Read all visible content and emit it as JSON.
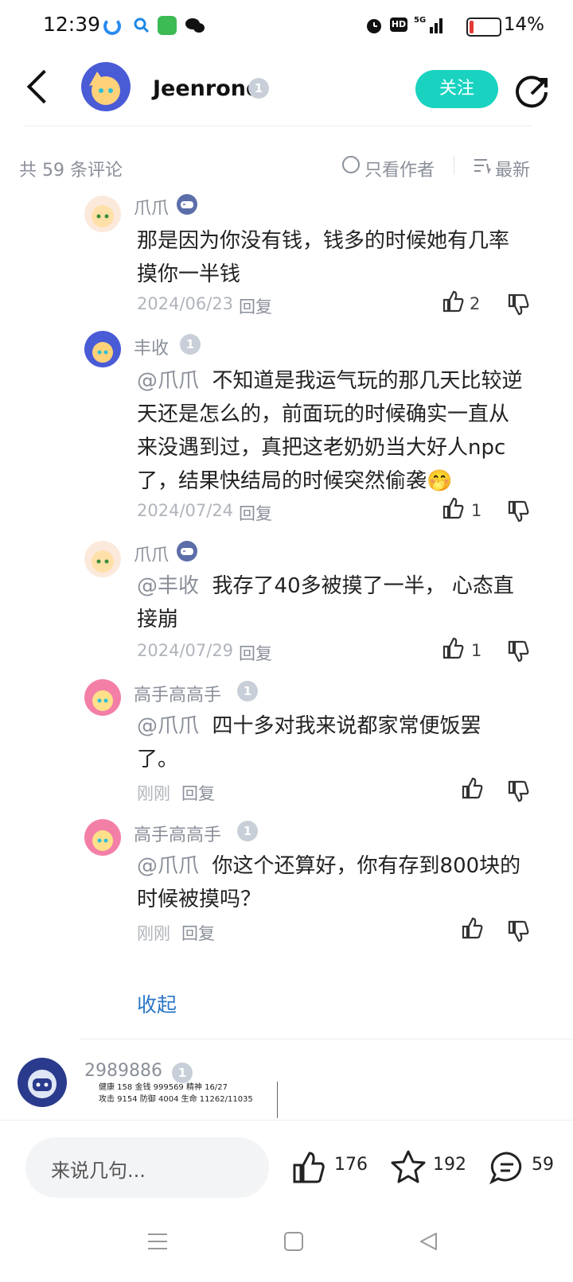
{
  "status_bar": {
    "time": "12:39",
    "battery": "14%",
    "battery_level": 0.14
  },
  "header": {
    "user_name": "Jeenrond",
    "follow_label": "关注"
  },
  "sort_bar": {
    "count_text": "共 59 条评论",
    "author_only": "只看作者",
    "sort_label": "最新"
  },
  "comments": [
    {
      "name": "爪爪",
      "mention": "",
      "text": "那是因为你没有钱，钱多的时候她有几率",
      "text2": "摸你一半钱",
      "date": "2024/06/23",
      "reply": "回复",
      "likes": "2"
    },
    {
      "name": "丰收",
      "mention": "@爪爪",
      "line1": "不知道是我运气玩的那几天比较逆",
      "line2": "天还是怎么的，前面玩的时候确实一直从",
      "line3": "来没遇到过，真把这老奶奶当大好人npc",
      "line4": "了，结果快结局的时候突然偷袭🤭",
      "date": "2024/07/24",
      "reply": "回复",
      "likes": "1"
    },
    {
      "name": "爪爪",
      "mention": "@丰收",
      "line1": "我存了40多被摸了一半， 心态直",
      "line2": "接崩",
      "date": "2024/07/29",
      "reply": "回复",
      "likes": "1"
    },
    {
      "name": "高手高高手",
      "mention": "@爪爪",
      "line1": "四十多对我来说都家常便饭罢",
      "line2": "了。",
      "date": "刚刚",
      "reply": "回复",
      "likes": ""
    },
    {
      "name": "高手高高手",
      "mention": "@爪爪",
      "line1": "你这个还算好，你有存到800块的",
      "line2": "时候被摸吗？",
      "date": "刚刚",
      "reply": "回复",
      "likes": ""
    }
  ],
  "collapse_label": "收起",
  "next_comment": {
    "name": "2989886",
    "shot_row1": "健康 158    金钱 999569 精神 16/27",
    "shot_row2": "攻击 9154  防御 4004  生命 11262/11035"
  },
  "bottom": {
    "input_placeholder": "来说几句...",
    "likes": "176",
    "favorites": "192",
    "comments": "59"
  },
  "level_badge": "1",
  "colors": {
    "accent": "#19d3c0",
    "link": "#2a76c6"
  }
}
